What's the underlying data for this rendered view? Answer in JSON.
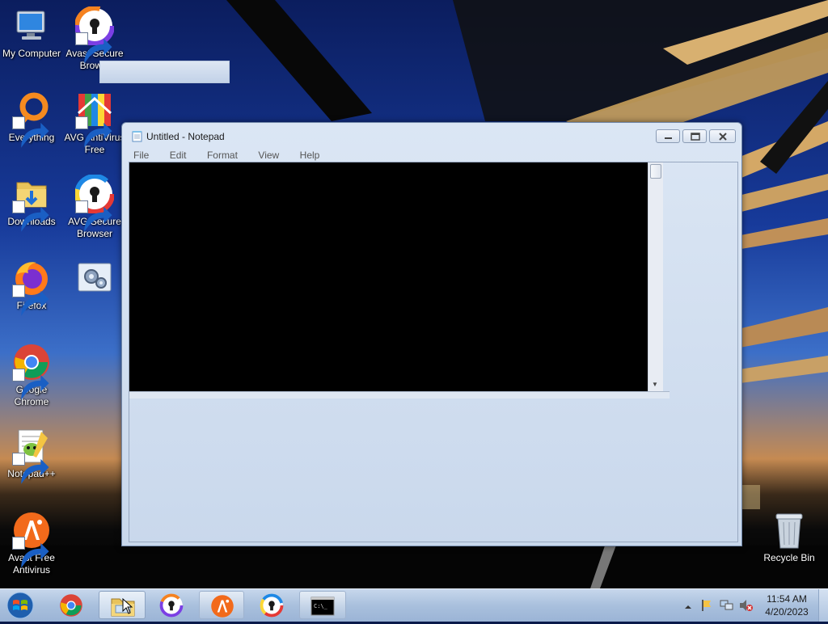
{
  "desktop": {
    "icons": [
      {
        "label": "My Computer",
        "icon": "computer-icon"
      },
      {
        "label": "Avast Secure Brow...",
        "icon": "avast-secure-browser-icon"
      },
      {
        "label": "Everything",
        "icon": "everything-icon"
      },
      {
        "label": "AVG AntiVirus Free",
        "icon": "avg-antivirus-icon"
      },
      {
        "label": "Downloads",
        "icon": "downloads-folder-icon"
      },
      {
        "label": "AVG Secure Browser",
        "icon": "avg-secure-browser-icon"
      },
      {
        "label": "Firefox",
        "icon": "firefox-icon"
      },
      {
        "label": "",
        "icon": "settings-gear-icon"
      },
      {
        "label": "Google Chrome",
        "icon": "chrome-icon"
      },
      {
        "label": "Notepad++",
        "icon": "notepadpp-icon"
      },
      {
        "label": "Avast Free Antivirus",
        "icon": "avast-antivirus-icon"
      }
    ],
    "recycle_bin": {
      "label": "Recycle Bin"
    }
  },
  "notepad": {
    "title": "Untitled - Notepad",
    "menu": [
      "File",
      "Edit",
      "Format",
      "View",
      "Help"
    ],
    "content": ""
  },
  "taskbar": {
    "items": [
      "chrome-icon",
      "file-explorer-icon",
      "avast-secure-browser-icon",
      "avast-antivirus-icon",
      "avg-secure-browser-icon",
      "command-prompt-icon"
    ],
    "command_prompt_glyph": "C:\\_",
    "clock": {
      "time": "11:54 AM",
      "date": "4/20/2023"
    }
  },
  "colors": {
    "taskbar": "#a9c0dd",
    "avast_orange": "#f26a1b",
    "chrome_red": "#db4437"
  }
}
